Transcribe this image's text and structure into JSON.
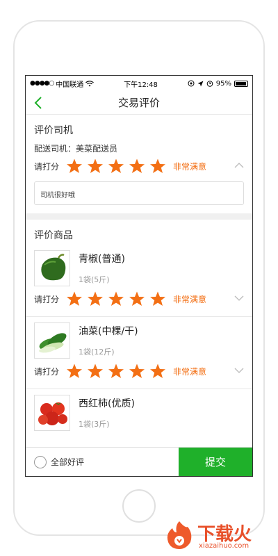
{
  "status_bar": {
    "signal": "●●●●○",
    "carrier": "中国联通",
    "time": "下午12:48",
    "battery": "95%"
  },
  "header": {
    "title": "交易评价"
  },
  "driver_section": {
    "title": "评价司机",
    "driver_line": "配送司机：美菜配送员",
    "rate_label": "请打分",
    "rating": 5,
    "rating_text": "非常满意",
    "comment": "司机很好哦"
  },
  "goods_section": {
    "title": "评价商品",
    "items": [
      {
        "name": "青椒(普通)",
        "qty": "1袋(5斤)",
        "rate_label": "请打分",
        "rating": 5,
        "rating_text": "非常满意"
      },
      {
        "name": "油菜(中棵/干)",
        "qty": "1袋(12斤)",
        "rate_label": "请打分",
        "rating": 5,
        "rating_text": "非常满意"
      },
      {
        "name": "西红柿(优质)",
        "qty": "1袋(3斤)"
      }
    ]
  },
  "bottom_bar": {
    "all_good_label": "全部好评",
    "submit_label": "提交"
  },
  "watermark": {
    "title": "下载火",
    "url": "xiazaihuo.com"
  },
  "colors": {
    "accent_green": "#1fb02a",
    "star_orange": "#f36f14",
    "text_orange": "#f36f14"
  }
}
